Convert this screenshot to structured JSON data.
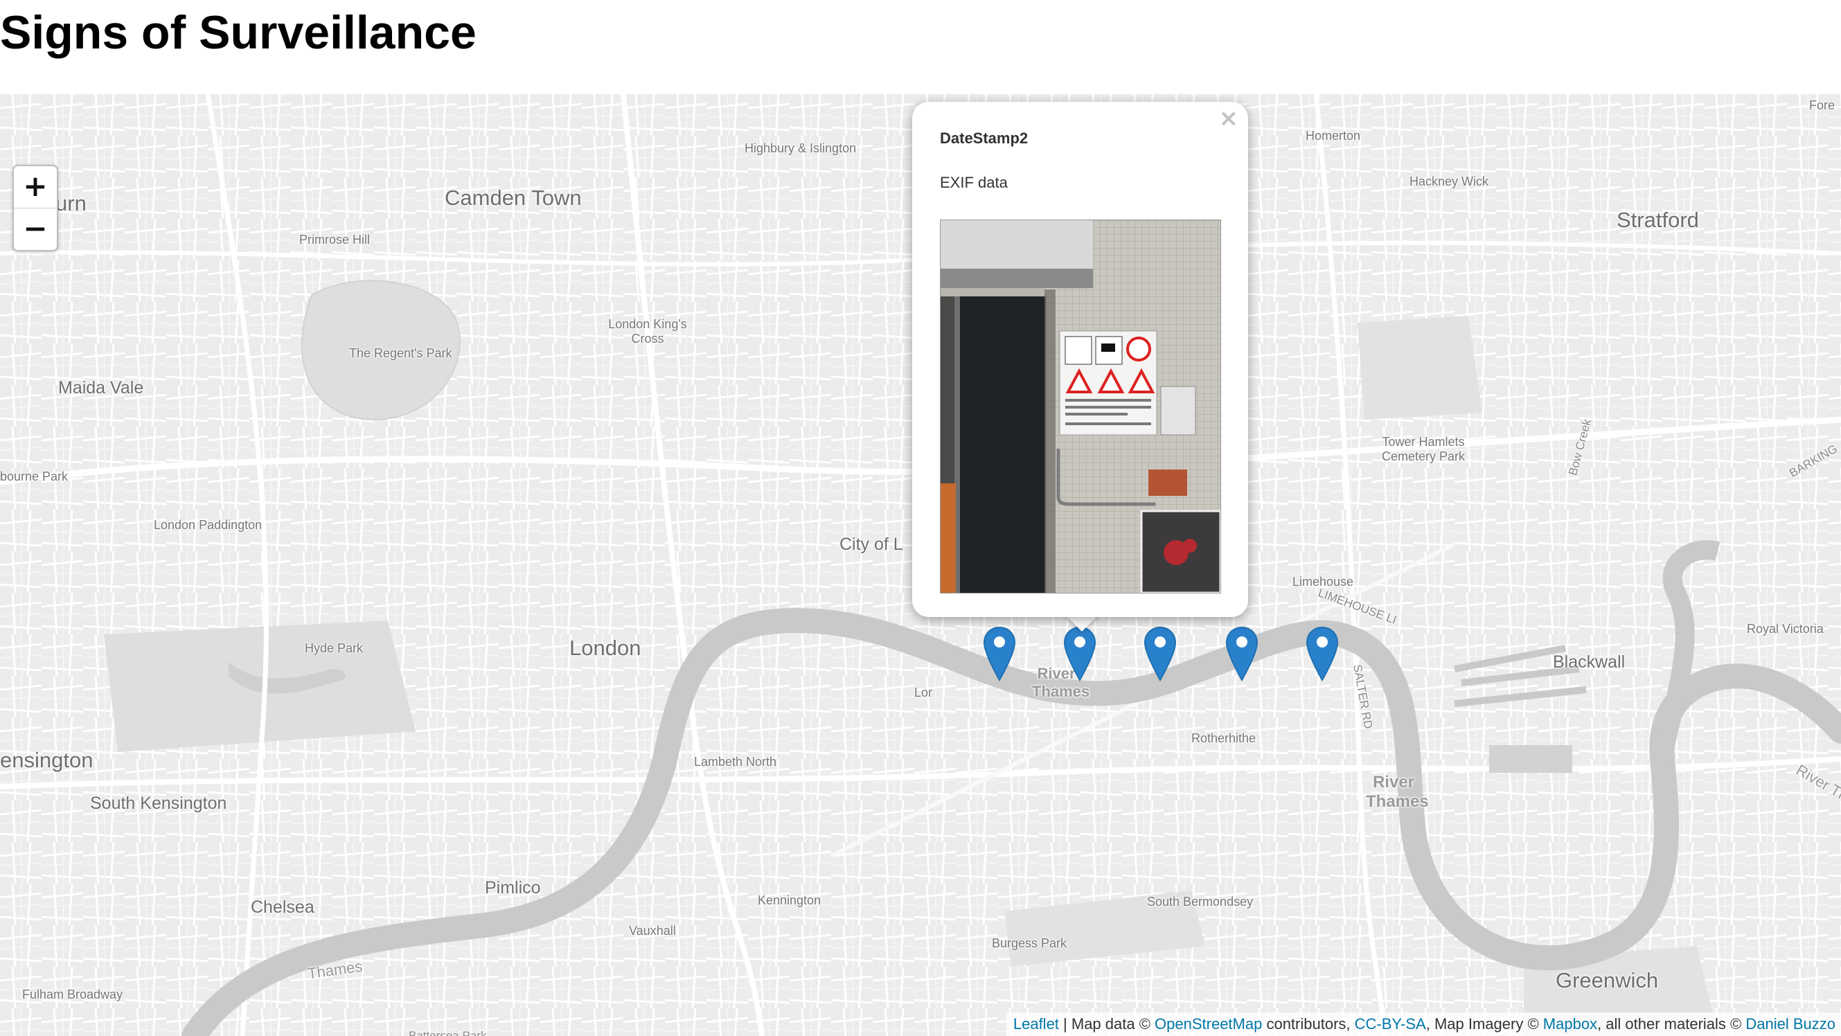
{
  "page": {
    "title": "Signs of Surveillance"
  },
  "map": {
    "zoom_in_label": "+",
    "zoom_out_label": "−",
    "places": {
      "camden_town": "Camden Town",
      "highbury": "Highbury & Islington",
      "homerton": "Homerton",
      "hackney_wick": "Hackney Wick",
      "stratford": "Stratford",
      "primrose_hill": "Primrose Hill",
      "kings_cross": "London King's Cross",
      "regents_park": "The Regent's Park",
      "maida_vale": "Maida Vale",
      "westbourne_park": "bourne Park",
      "tower_hamlets": "Tower Hamlets Cemetery Park",
      "bow_creek": "Bow Creek",
      "barking": "BARKING",
      "paddington": "London Paddington",
      "city_of_london": "City of L",
      "limehouse": "Limehouse",
      "limehouse_link": "LIMEHOUSE LI",
      "royal_victoria": "Royal Victoria",
      "hyde_park": "Hyde Park",
      "london": "London",
      "river_thames_1": "River Thames",
      "lor": "Lor",
      "salter_rd": "SALTER RD",
      "blackwall": "Blackwall",
      "river_thames_east": "River Tl",
      "rotherhithe": "Rotherhithe",
      "kensington": "ensington",
      "lambeth_north": "Lambeth North",
      "south_kensington": "South Kensington",
      "river_thames_2": "River Thames",
      "pimlico": "Pimlico",
      "chelsea": "Chelsea",
      "kennington": "Kennington",
      "south_bermondsey": "South Bermondsey",
      "vauxhall": "Vauxhall",
      "burgess_park": "Burgess Park",
      "thames": "Thames",
      "greenwich": "Greenwich",
      "fulham_broadway": "Fulham Broadway",
      "battersea_park": "Battersea Park",
      "forest": "Fore",
      "partial_born": "urn"
    },
    "markers": [
      {
        "icon": "map-marker-icon",
        "color": "#2a81cb"
      },
      {
        "icon": "map-marker-icon",
        "color": "#2a81cb"
      },
      {
        "icon": "map-marker-icon",
        "color": "#2a81cb"
      },
      {
        "icon": "map-marker-icon",
        "color": "#2a81cb"
      },
      {
        "icon": "map-marker-icon",
        "color": "#2a81cb"
      }
    ],
    "popup": {
      "close_label": "×",
      "title": "DateStamp2",
      "description": "EXIF data",
      "image_alt": "Photo of surveillance warning signs on a tiled wall next to a garage door"
    },
    "attribution": {
      "leaflet": "Leaflet",
      "sep1": " | Map data © ",
      "osm": "OpenStreetMap",
      "contributors": " contributors, ",
      "ccbysa": "CC-BY-SA",
      "imagery": ", Map Imagery © ",
      "mapbox": "Mapbox",
      "other": ", all other materials © ",
      "author": "Daniel Buzzo"
    }
  }
}
